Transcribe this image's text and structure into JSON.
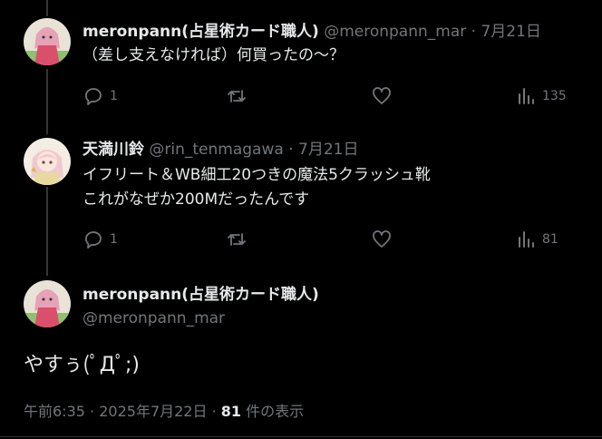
{
  "reply1": {
    "name": "meronpann(占星術カード職人)",
    "handle": "@meronpann_mar",
    "separator": "·",
    "date": "7月21日",
    "text": "（差し支えなければ）何買ったの～？",
    "replies": "1",
    "views": "135"
  },
  "reply2": {
    "name": "天満川鈴",
    "handle": "@rin_tenmagawa",
    "separator": "·",
    "date": "7月21日",
    "text_line1": "イフリート＆WB細工20つきの魔法5クラッシュ靴",
    "text_line2": "これがなぜか200Mだったんです",
    "replies": "1",
    "views": "81"
  },
  "main": {
    "name": "meronpann(占星術カード職人)",
    "handle": "@meronpann_mar",
    "text": "やすぅ(ﾟДﾟ;)",
    "time": "午前6:35",
    "date": "2025年7月22日",
    "separator": "·",
    "views_count": "81",
    "views_label": "件の表示"
  },
  "colors": {
    "background": "#000000",
    "text": "#e7e9ea",
    "muted": "#71767b",
    "line": "#333639"
  },
  "icons": [
    "reply-icon",
    "retweet-icon",
    "like-icon",
    "views-icon"
  ]
}
